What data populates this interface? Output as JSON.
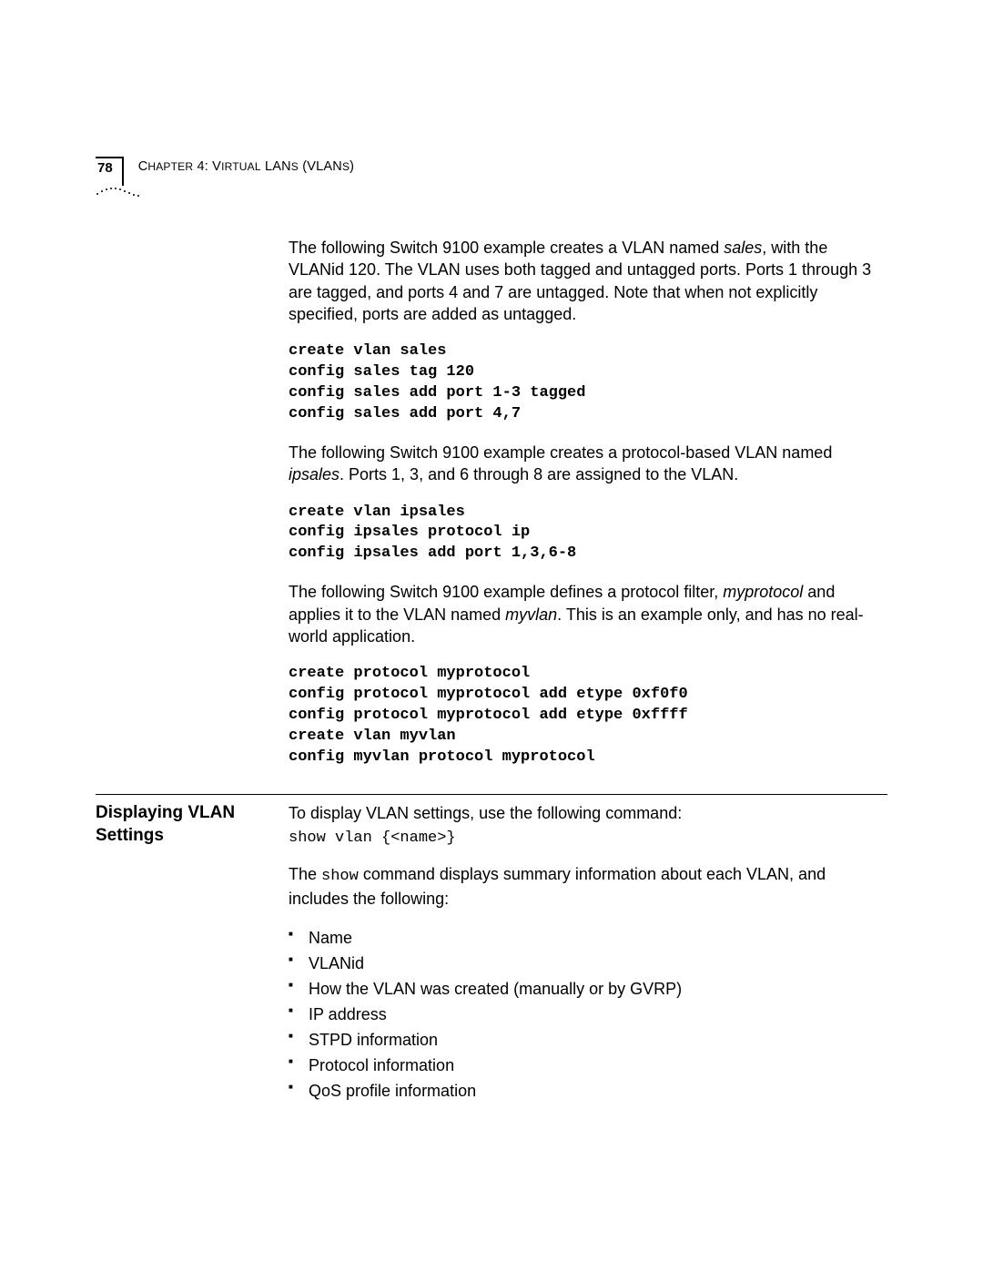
{
  "header": {
    "page_number": "78",
    "chapter_label": "Chapter 4: Virtual LANs (VLANs)"
  },
  "body": {
    "para1_pre": "The following Switch 9100 example creates a VLAN named ",
    "para1_ital": "sales",
    "para1_post": ", with the VLANid 120. The VLAN uses both tagged and untagged ports. Ports 1 through 3 are tagged, and ports 4 and 7 are untagged. Note that when not explicitly specified, ports are added as untagged.",
    "code1": "create vlan sales\nconfig sales tag 120\nconfig sales add port 1-3 tagged\nconfig sales add port 4,7",
    "para2_pre": "The following Switch 9100 example creates a protocol-based VLAN named ",
    "para2_ital": "ipsales",
    "para2_post": ". Ports 1, 3, and 6 through 8 are assigned to the VLAN.",
    "code2": "create vlan ipsales\nconfig ipsales protocol ip\nconfig ipsales add port 1,3,6-8",
    "para3_pre": "The following Switch 9100 example defines a protocol filter, ",
    "para3_ital1": "myprotocol",
    "para3_mid": " and applies it to the VLAN named ",
    "para3_ital2": "myvlan",
    "para3_post": ". This is an example only, and has no real-world application.",
    "code3": "create protocol myprotocol\nconfig protocol myprotocol add etype 0xf0f0\nconfig protocol myprotocol add etype 0xffff\ncreate vlan myvlan\nconfig myvlan protocol myprotocol"
  },
  "section": {
    "heading": "Displaying VLAN Settings",
    "intro": "To display VLAN settings, use the following command:",
    "syntax": "show vlan {<name>}",
    "desc_pre": "The ",
    "desc_code": "show",
    "desc_post": " command displays summary information about each VLAN, and includes the following:",
    "bullets": [
      "Name",
      "VLANid",
      "How the VLAN was created (manually or by GVRP)",
      "IP address",
      "STPD information",
      "Protocol information",
      "QoS profile information"
    ]
  }
}
